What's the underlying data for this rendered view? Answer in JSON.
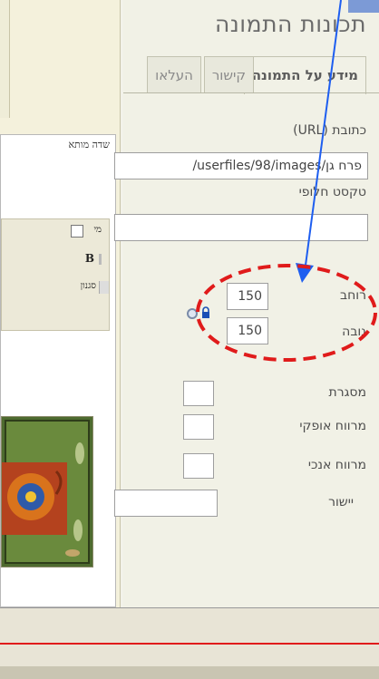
{
  "dialog": {
    "title": "תכונות התמונה",
    "tabs": [
      {
        "label": "מידע על התמונה",
        "active": true
      },
      {
        "label": "קישור",
        "active": false
      },
      {
        "label": "העלאו",
        "active": false
      }
    ],
    "url_label": "כתובת (URL)",
    "url_value": "/userfiles/98/images/פרח גן",
    "alt_label": "טקסט חלופי",
    "alt_value": "",
    "width_label": "רוחב",
    "width_value": "150",
    "height_label": "גובה",
    "height_value": "150",
    "border_label": "מסגרת",
    "hspace_label": "מרווח אופקי",
    "vspace_label": "מרווח אנכי",
    "align_label": "יישור"
  },
  "editor": {
    "field_label": "שדה מותא",
    "style_label": "מי",
    "bold_label": "B",
    "style_dropdown": "סגנון"
  },
  "colors": {
    "annotation_red": "#e01b1b",
    "arrow_blue": "#1e5ef0",
    "title_gray": "#6b6b6b",
    "lock_blue": "#1b4fb5"
  },
  "icons": {
    "lock": "lock-icon",
    "reset": "reset-size-icon",
    "dropdown": "chevron-down-icon"
  }
}
